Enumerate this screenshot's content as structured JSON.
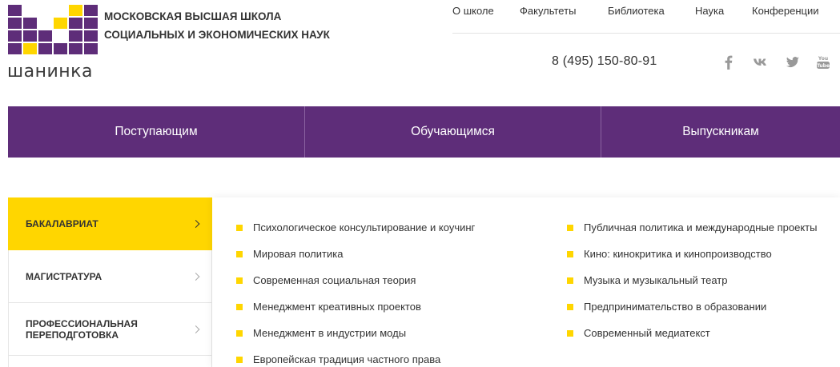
{
  "logo": {
    "word": "шанинка",
    "colors": {
      "purple": "#5e2d79",
      "yellow": "#ffd600",
      "white": "#ffffff"
    }
  },
  "org_name": {
    "line1": "МОСКОВСКАЯ ВЫСШАЯ ШКОЛА",
    "line2": "СОЦИАЛЬНЫХ И ЭКОНОМИЧЕСКИХ НАУК"
  },
  "top_menu": [
    {
      "label": "О школе"
    },
    {
      "label": "Факультеты"
    },
    {
      "label": "Библиотека"
    },
    {
      "label": "Наука"
    },
    {
      "label": "Конференции"
    }
  ],
  "phone": "8 (495) 150-80-91",
  "social_icons": [
    "facebook-icon",
    "vk-icon",
    "twitter-icon",
    "youtube-icon"
  ],
  "main_nav": [
    {
      "label": "Поступающим"
    },
    {
      "label": "Обучающимся"
    },
    {
      "label": "Выпускникам"
    }
  ],
  "sidebar": {
    "items": [
      {
        "label": "БАКАЛАВРИАТ",
        "active": true
      },
      {
        "label": "МАГИСТРАТУРА",
        "active": false
      },
      {
        "label": "ПРОФЕССИОНАЛЬНАЯ ПЕРЕПОДГОТОВКА",
        "active": false
      }
    ]
  },
  "programs": {
    "left": [
      "Психологическое консультирование и коучинг",
      "Мировая политика",
      "Современная социальная теория",
      "Менеджмент креативных проектов",
      "Менеджмент в индустрии моды",
      "Европейская традиция частного права"
    ],
    "right": [
      "Публичная политика и международные проекты",
      "Кино: кинокритика и кинопроизводство",
      "Музыка и музыкальный театр",
      "Предпринимательство в образовании",
      "Современный медиатекст"
    ]
  },
  "colors": {
    "accent_purple": "#5e2d79",
    "accent_yellow": "#ffd600",
    "text": "#333333"
  }
}
